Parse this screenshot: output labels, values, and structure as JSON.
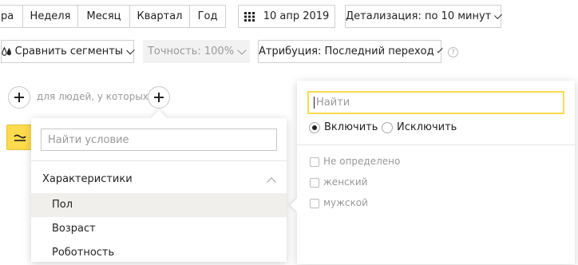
{
  "toolbar": {
    "period_tabs": [
      {
        "label": "ра"
      },
      {
        "label": "Неделя"
      },
      {
        "label": "Месяц"
      },
      {
        "label": "Квартал"
      },
      {
        "label": "Год"
      }
    ],
    "date_label": "10 апр 2019",
    "detail_label": "Детализация: по 10 минут",
    "compare_label": "Сравнить сегменты",
    "accuracy_label": "Точность: 100%",
    "attribution_label": "Атрибуция: Последний переход",
    "help_icon": "?"
  },
  "segment_row": {
    "people_text": "для людей, у которых"
  },
  "condition_dropdown": {
    "search_placeholder": "Найти условие",
    "group_label": "Характеристики",
    "items": [
      {
        "label": "Пол"
      },
      {
        "label": "Возраст"
      },
      {
        "label": "Роботность"
      }
    ]
  },
  "value_panel": {
    "search_placeholder": "Найти",
    "include_label": "Включить",
    "exclude_label": "Исключить",
    "options": [
      {
        "label": "Не определено"
      },
      {
        "label": "женский"
      },
      {
        "label": "мужской"
      }
    ]
  },
  "colors": {
    "accent_yellow": "#ffdb4d",
    "highlight_row": "#f0efec"
  }
}
